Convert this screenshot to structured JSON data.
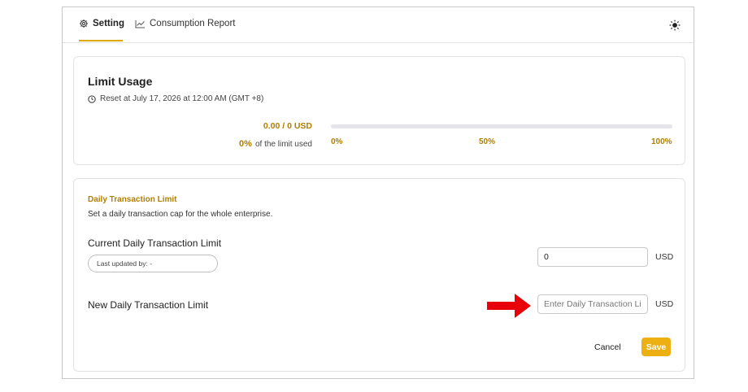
{
  "tabs": {
    "setting_label": "Setting",
    "report_label": "Consumption Report"
  },
  "usage": {
    "title": "Limit Usage",
    "reset_text": "Reset at July 17, 2026 at 12:00 AM (GMT +8)",
    "amount_text": "0.00 / 0 USD",
    "percent_value": "0%",
    "percent_suffix": "of the limit used",
    "progress_fraction": 0,
    "ticks": [
      "0%",
      "50%",
      "100%"
    ]
  },
  "limit": {
    "section_title": "Daily Transaction Limit",
    "section_desc": "Set a daily transaction cap for the whole enterprise.",
    "current_label": "Current Daily Transaction Limit",
    "last_updated": "Last updated by: -",
    "current_value": "0",
    "new_label": "New Daily Transaction Limit",
    "new_placeholder": "Enter Daily Transaction Limit",
    "unit": "USD",
    "cancel_label": "Cancel",
    "save_label": "Save"
  },
  "colors": {
    "accent": "#e0a800",
    "accent_text": "#b07e00",
    "arrow": "#e8000b"
  },
  "icons": {
    "setting": "gear-icon",
    "report": "line-chart-icon",
    "theme": "sun-icon",
    "reset": "clock-icon",
    "pointer": "red-arrow-icon"
  }
}
